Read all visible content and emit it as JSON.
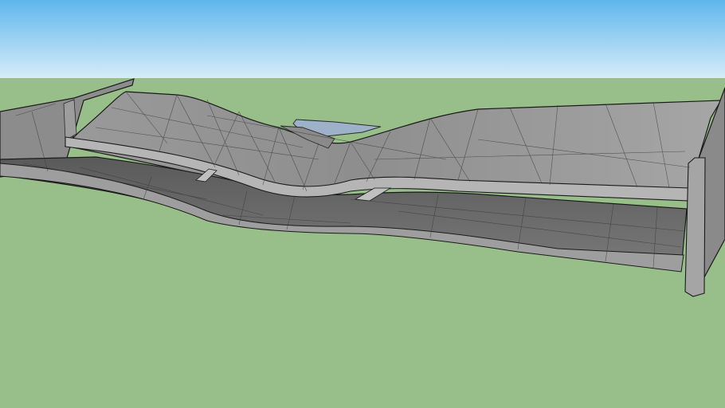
{
  "scene": {
    "object": "3d-wing-model",
    "render_style": "shaded-wireframe",
    "colors": {
      "sky_top": "#5fb6ec",
      "sky_bottom": "#d7ecf8",
      "ground": "#98bf8a",
      "surface_light": "#a9a9a9",
      "surface_mid": "#8f8f8f",
      "surface_dark": "#6f6f6f",
      "underside": "#5c5c5c",
      "edge": "#1a1a1a",
      "mesh_line": "#3a3a3a",
      "glass": "#9db2c9"
    }
  }
}
